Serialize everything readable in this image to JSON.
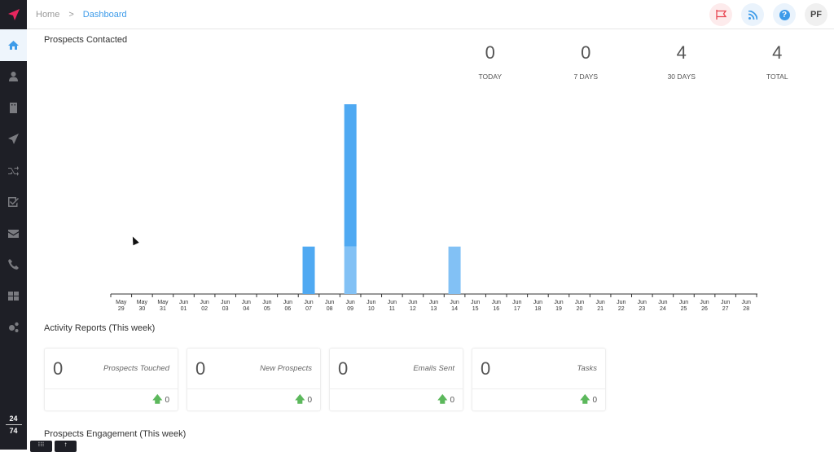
{
  "breadcrumb": {
    "home": "Home",
    "separator": ">",
    "current": "Dashboard"
  },
  "top_icons": [
    {
      "name": "flag-icon",
      "label": "",
      "color": "#e8434f",
      "bg": "#fdebec"
    },
    {
      "name": "rss-icon",
      "label": "",
      "color": "#3d9be9",
      "bg": "#eaf3fc"
    },
    {
      "name": "help-icon",
      "label": "?",
      "color": "#3d9be9",
      "bg": "#eaf3fc"
    },
    {
      "name": "user-avatar",
      "label": "PF",
      "color": "#444",
      "bg": "#f0f0f0"
    }
  ],
  "sidebar": {
    "items": [
      {
        "name": "home",
        "active": true
      },
      {
        "name": "prospects"
      },
      {
        "name": "companies"
      },
      {
        "name": "campaigns"
      },
      {
        "name": "sequences"
      },
      {
        "name": "tasks"
      },
      {
        "name": "emails"
      },
      {
        "name": "calls"
      },
      {
        "name": "apps"
      },
      {
        "name": "settings"
      }
    ],
    "counter_top": "24",
    "counter_bottom": "74"
  },
  "prospects_contacted": {
    "title": "Prospects Contacted",
    "stats": [
      {
        "value": "0",
        "label": "TODAY"
      },
      {
        "value": "0",
        "label": "7 DAYS"
      },
      {
        "value": "4",
        "label": "30 DAYS"
      },
      {
        "value": "4",
        "label": "TOTAL"
      }
    ]
  },
  "chart_data": {
    "type": "bar",
    "stacked": true,
    "title": "Prospects Contacted",
    "xlabel": "",
    "ylabel": "",
    "ylim": [
      0,
      4
    ],
    "grid": false,
    "categories": [
      "May 29",
      "May 30",
      "May 31",
      "Jun 01",
      "Jun 02",
      "Jun 03",
      "Jun 04",
      "Jun 05",
      "Jun 06",
      "Jun 07",
      "Jun 08",
      "Jun 09",
      "Jun 10",
      "Jun 11",
      "Jun 12",
      "Jun 13",
      "Jun 14",
      "Jun 15",
      "Jun 16",
      "Jun 17",
      "Jun 18",
      "Jun 19",
      "Jun 20",
      "Jun 21",
      "Jun 22",
      "Jun 23",
      "Jun 24",
      "Jun 25",
      "Jun 26",
      "Jun 27",
      "Jun 28"
    ],
    "series": [
      {
        "name": "light",
        "color": "#82c1f5",
        "values": [
          0,
          0,
          0,
          0,
          0,
          0,
          0,
          0,
          0,
          0,
          0,
          1,
          0,
          0,
          0,
          0,
          1,
          0,
          0,
          0,
          0,
          0,
          0,
          0,
          0,
          0,
          0,
          0,
          0,
          0,
          0
        ]
      },
      {
        "name": "dark",
        "color": "#4fa9f2",
        "values": [
          0,
          0,
          0,
          0,
          0,
          0,
          0,
          0,
          0,
          1,
          0,
          3,
          0,
          0,
          0,
          0,
          0,
          0,
          0,
          0,
          0,
          0,
          0,
          0,
          0,
          0,
          0,
          0,
          0,
          0,
          0
        ]
      }
    ]
  },
  "activity": {
    "title": "Activity Reports (This week)",
    "cards": [
      {
        "value": "0",
        "label": "Prospects Touched",
        "change": "0"
      },
      {
        "value": "0",
        "label": "New Prospects",
        "change": "0"
      },
      {
        "value": "0",
        "label": "Emails Sent",
        "change": "0"
      },
      {
        "value": "0",
        "label": "Tasks",
        "change": "0"
      }
    ]
  },
  "engagement": {
    "title": "Prospects Engagement (This week)"
  },
  "float_buttons": [
    {
      "label": "⁝⁝⁝"
    },
    {
      "label": "↑"
    }
  ]
}
